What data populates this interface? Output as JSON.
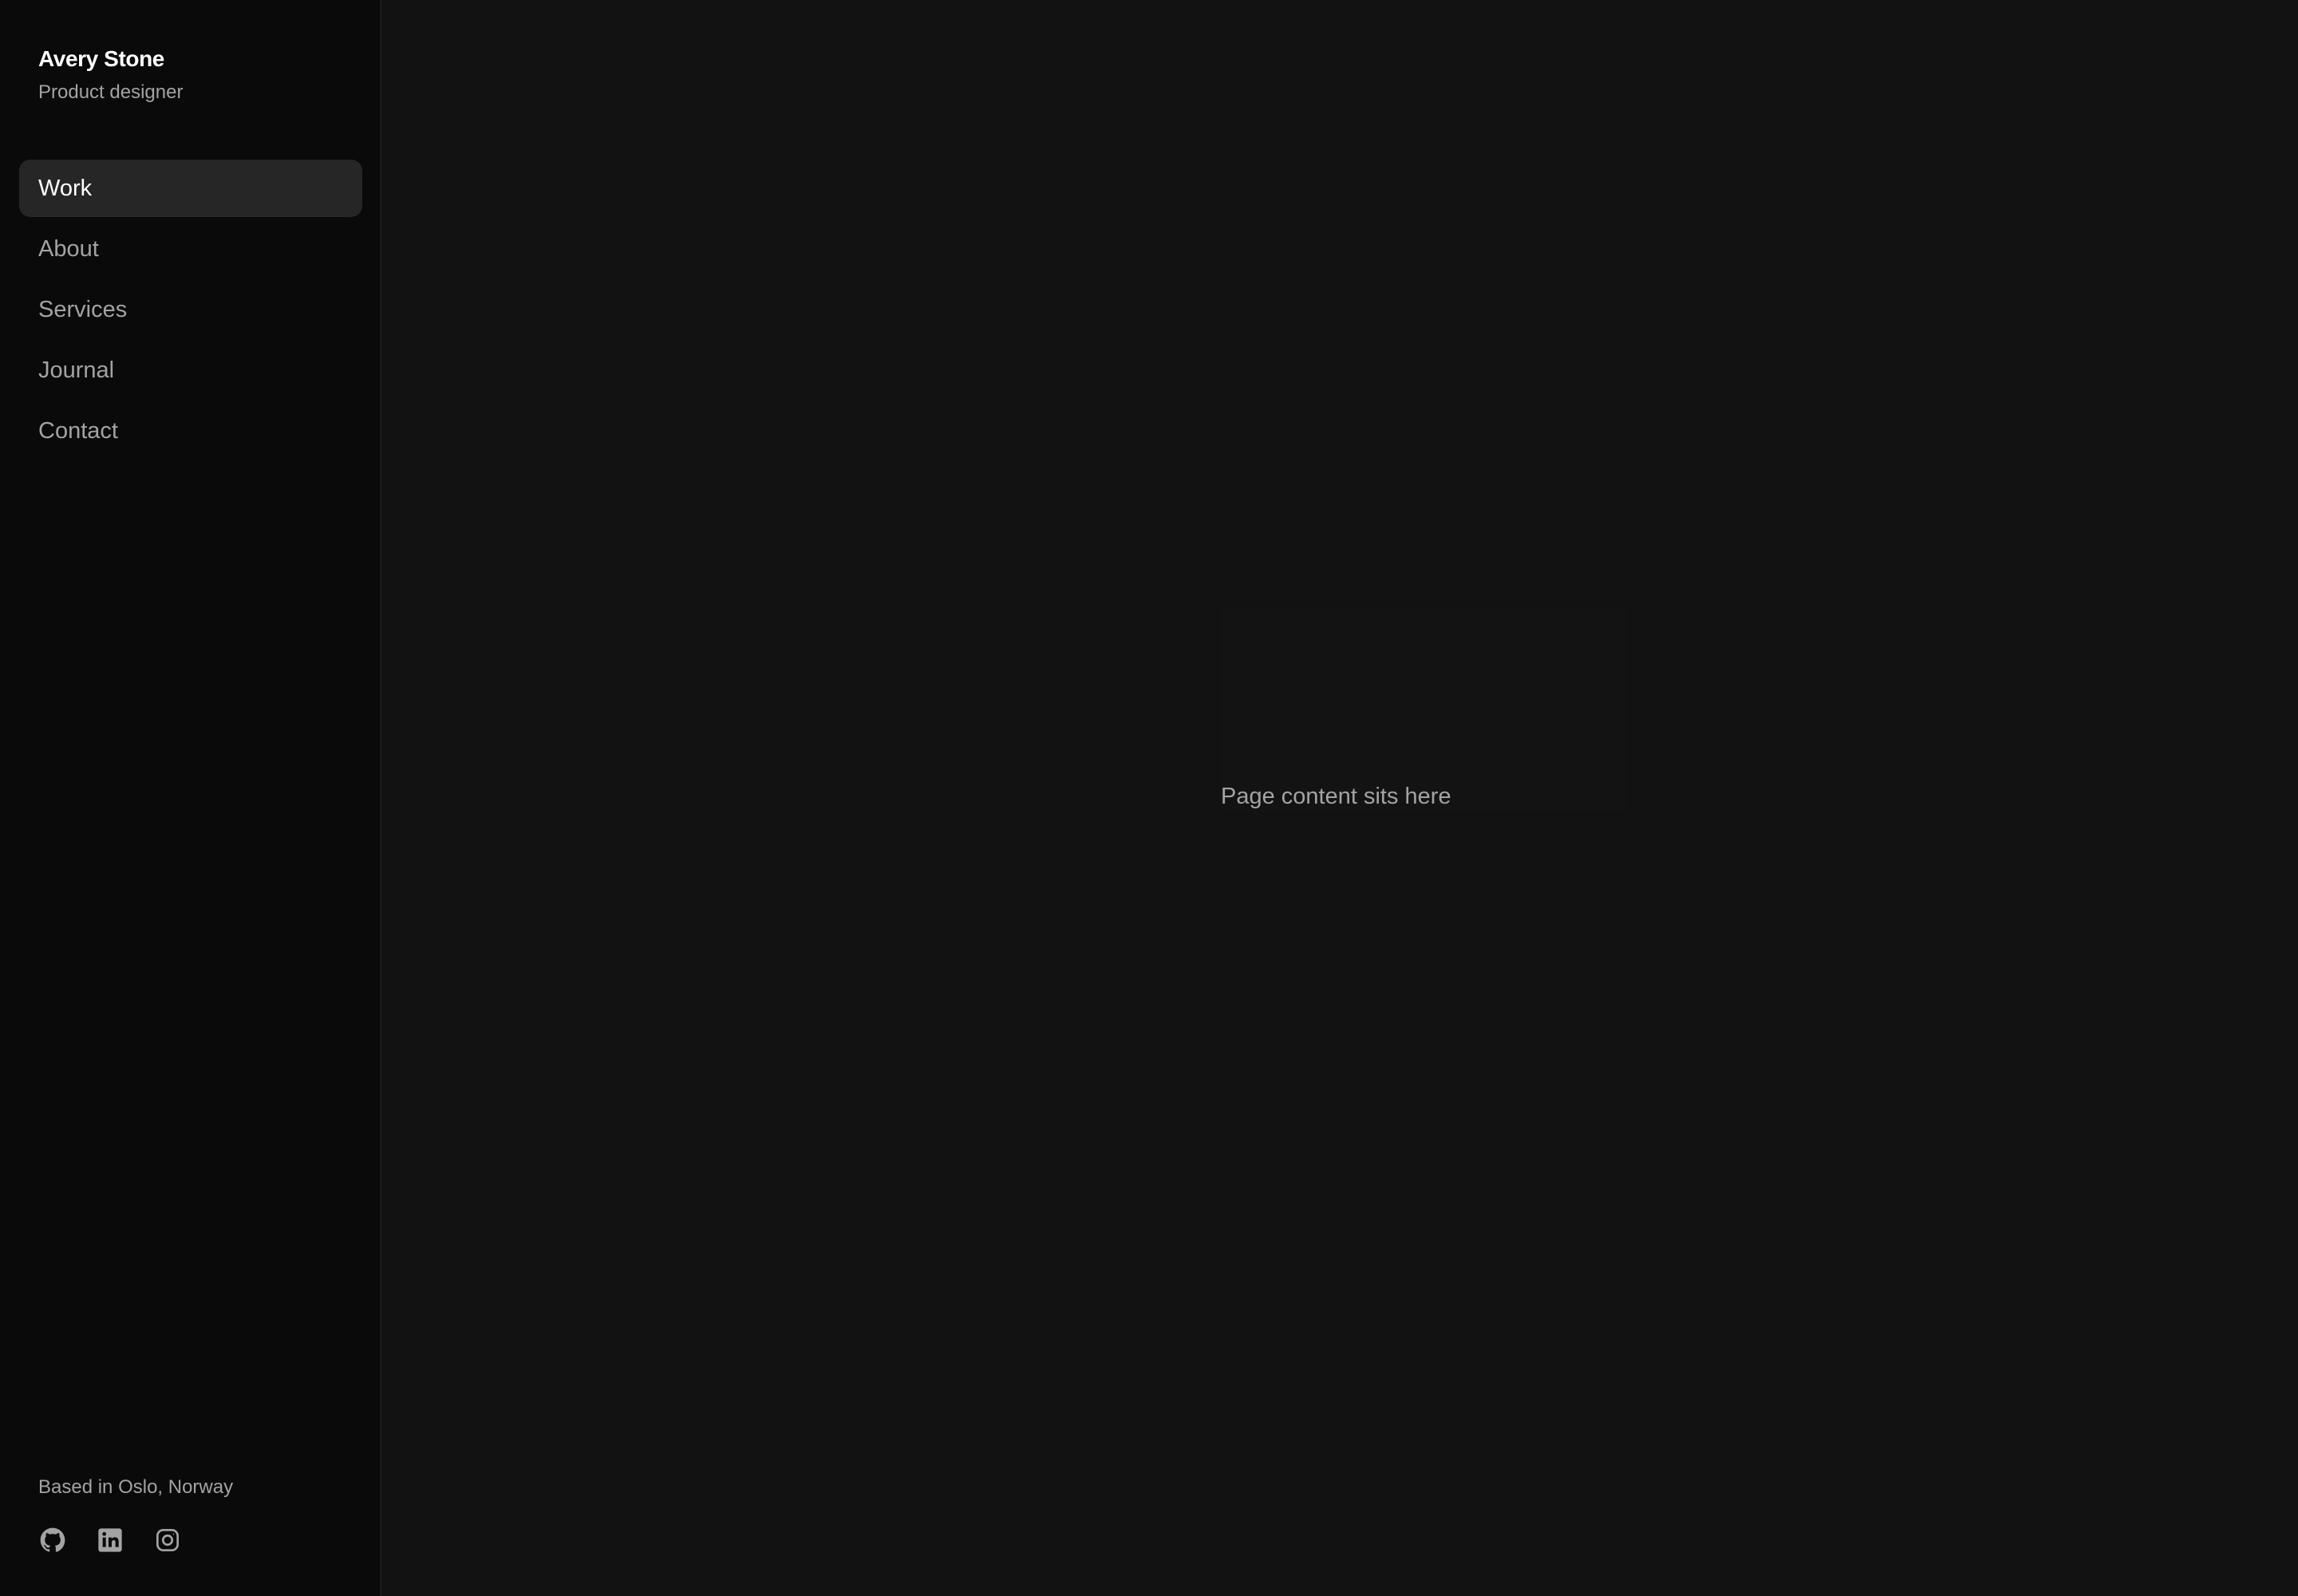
{
  "profile": {
    "name": "Avery Stone",
    "role": "Product designer"
  },
  "nav": {
    "items": [
      {
        "label": "Work",
        "active": true
      },
      {
        "label": "About",
        "active": false
      },
      {
        "label": "Services",
        "active": false
      },
      {
        "label": "Journal",
        "active": false
      },
      {
        "label": "Contact",
        "active": false
      }
    ]
  },
  "footer": {
    "location": "Based in Oslo, Norway",
    "socials": [
      {
        "icon": "github-icon"
      },
      {
        "icon": "linkedin-icon"
      },
      {
        "icon": "instagram-icon"
      }
    ]
  },
  "main": {
    "placeholder": "Page content sits here"
  },
  "colors": {
    "sidebar_bg": "#0a0a0a",
    "main_bg": "#121212",
    "active_item_bg": "#262626",
    "text_primary": "#ffffff",
    "text_muted": "#a3a3a3"
  }
}
